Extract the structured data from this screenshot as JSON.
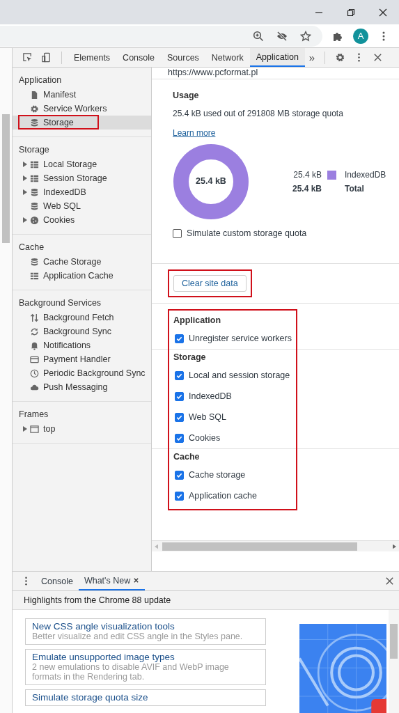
{
  "browser": {
    "avatar_letter": "A"
  },
  "devtools": {
    "tabs": [
      {
        "label": "Elements",
        "selected": false
      },
      {
        "label": "Console",
        "selected": false
      },
      {
        "label": "Sources",
        "selected": false
      },
      {
        "label": "Network",
        "selected": false
      },
      {
        "label": "Application",
        "selected": true
      }
    ],
    "more_tabs": "»"
  },
  "sidebar": {
    "sections": [
      {
        "title": "Application",
        "items": [
          {
            "label": "Manifest",
            "expandable": false,
            "selected": false,
            "highlighted": false
          },
          {
            "label": "Service Workers",
            "expandable": false,
            "selected": false,
            "highlighted": false
          },
          {
            "label": "Storage",
            "expandable": false,
            "selected": true,
            "highlighted": true
          }
        ]
      },
      {
        "title": "Storage",
        "items": [
          {
            "label": "Local Storage",
            "expandable": true,
            "selected": false,
            "highlighted": false
          },
          {
            "label": "Session Storage",
            "expandable": true,
            "selected": false,
            "highlighted": false
          },
          {
            "label": "IndexedDB",
            "expandable": true,
            "selected": false,
            "highlighted": false
          },
          {
            "label": "Web SQL",
            "expandable": false,
            "selected": false,
            "highlighted": false
          },
          {
            "label": "Cookies",
            "expandable": true,
            "selected": false,
            "highlighted": false
          }
        ]
      },
      {
        "title": "Cache",
        "items": [
          {
            "label": "Cache Storage",
            "expandable": false,
            "selected": false,
            "highlighted": false
          },
          {
            "label": "Application Cache",
            "expandable": false,
            "selected": false,
            "highlighted": false
          }
        ]
      },
      {
        "title": "Background Services",
        "items": [
          {
            "label": "Background Fetch",
            "expandable": false,
            "selected": false,
            "highlighted": false
          },
          {
            "label": "Background Sync",
            "expandable": false,
            "selected": false,
            "highlighted": false
          },
          {
            "label": "Notifications",
            "expandable": false,
            "selected": false,
            "highlighted": false
          },
          {
            "label": "Payment Handler",
            "expandable": false,
            "selected": false,
            "highlighted": false
          },
          {
            "label": "Periodic Background Sync",
            "expandable": false,
            "selected": false,
            "highlighted": false
          },
          {
            "label": "Push Messaging",
            "expandable": false,
            "selected": false,
            "highlighted": false
          }
        ]
      },
      {
        "title": "Frames",
        "items": [
          {
            "label": "top",
            "expandable": true,
            "selected": false,
            "highlighted": false
          }
        ]
      }
    ]
  },
  "main": {
    "origin": "https://www.pcformat.pl",
    "usage": {
      "title": "Usage",
      "summary": "25.4 kB used out of 291808 MB storage quota",
      "link": "Learn more",
      "donut_label": "25.4 kB",
      "legend": [
        {
          "value": "25.4 kB",
          "label": "IndexedDB",
          "color": "#9b7fe0"
        }
      ],
      "total": {
        "value": "25.4 kB",
        "label": "Total"
      },
      "simulate": {
        "label": "Simulate custom storage quota",
        "checked": false
      }
    },
    "clear_button": {
      "label": "Clear site data",
      "highlighted": true
    },
    "options": {
      "highlighted": true,
      "groups": [
        {
          "title": "Application",
          "items": [
            {
              "label": "Unregister service workers",
              "checked": true
            }
          ]
        },
        {
          "title": "Storage",
          "items": [
            {
              "label": "Local and session storage",
              "checked": true
            },
            {
              "label": "IndexedDB",
              "checked": true
            },
            {
              "label": "Web SQL",
              "checked": true
            },
            {
              "label": "Cookies",
              "checked": true
            }
          ]
        },
        {
          "title": "Cache",
          "items": [
            {
              "label": "Cache storage",
              "checked": true
            },
            {
              "label": "Application cache",
              "checked": true
            }
          ]
        }
      ]
    }
  },
  "drawer": {
    "tabs": [
      {
        "label": "Console",
        "selected": false,
        "closable": false
      },
      {
        "label": "What's New",
        "selected": true,
        "closable": true
      }
    ],
    "headline": "Highlights from the Chrome 88 update",
    "cards": [
      {
        "title": "New CSS angle visualization tools",
        "description": "Better visualize and edit CSS angle in the Styles pane."
      },
      {
        "title": "Emulate unsupported image types",
        "description": "2 new emulations to disable AVIF and WebP image formats in the Rendering tab."
      },
      {
        "title": "Simulate storage quota size"
      }
    ]
  }
}
